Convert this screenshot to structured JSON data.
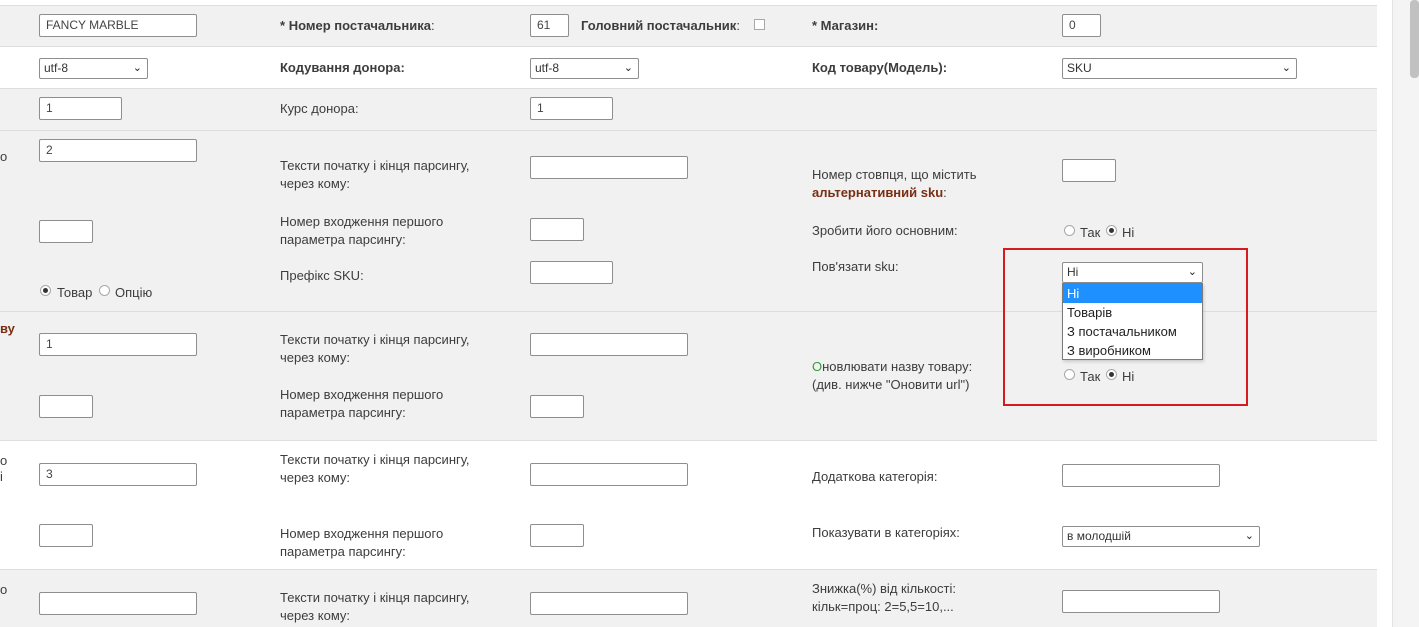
{
  "row1": {
    "name_value": "FANCY MARBLE",
    "supplier_number_label_star": "*",
    "supplier_number_label": "Номер постачальника",
    "supplier_number_colon": ":",
    "supplier_number_value": "61",
    "main_supplier_label": "Головний постачальник",
    "main_supplier_colon": ":",
    "store_label": "* Магазин:",
    "store_value": "0"
  },
  "row2": {
    "encoding_value": "utf-8",
    "donor_encoding_label": "Кодування донора:",
    "donor_encoding_value": "utf-8",
    "product_code_label": "Код товару(Модель):",
    "product_code_value": "SKU"
  },
  "row3": {
    "value1": "1",
    "donor_rate_label": "Курс донора:",
    "donor_rate_value": "1"
  },
  "section_sku": {
    "left_edge_char": "о",
    "column_value": "2",
    "texts_label_1": "Тексти початку і кінця парсингу,",
    "texts_label_2": "через кому:",
    "alt_col_label_1": "Номер стовпця, що містить",
    "alt_col_label_2": "альтернативний sku",
    "alt_col_label_3": ":",
    "first_occurrence_label_1": "Номер входження першого",
    "first_occurrence_label_2": "параметра парсингу:",
    "make_main_label": "Зробити його основним:",
    "yes": "Так",
    "no": "Ні",
    "sku_prefix_label": "Префікс SKU:",
    "link_sku_label": "Пов'язати sku:",
    "link_sku_value": "Ні",
    "type_product": "Товар",
    "type_option": "Опцію",
    "dropdown_options": [
      "Ні",
      "Товарів",
      "З постачальником",
      "З виробником"
    ]
  },
  "section_name": {
    "left_edge_text": "ву",
    "column_value": "1",
    "texts_label_1": "Тексти початку і кінця парсингу,",
    "texts_label_2": "через кому:",
    "update_name_first": "О",
    "update_name_rest": "новлювати назву товару:",
    "update_name_hint": "(див. нижче \"Оновити url\")",
    "first_occurrence_label_1": "Номер входження першого",
    "first_occurrence_label_2": "параметра парсингу:",
    "yes": "Так",
    "no": "Ні"
  },
  "section_category": {
    "left_edge_char_1": "о",
    "left_edge_char_2": "і",
    "column_value": "3",
    "texts_label_1": "Тексти початку і кінця парсингу,",
    "texts_label_2": "через кому:",
    "extra_category_label": "Додаткова категорія:",
    "first_occurrence_label_1": "Номер входження першого",
    "first_occurrence_label_2": "параметра парсингу:",
    "show_in_categories_label": "Показувати в категоріях:",
    "show_in_categories_value": "в молодшій"
  },
  "section_discount": {
    "left_edge_char": "о",
    "texts_label_1": "Тексти початку і кінця парсингу,",
    "texts_label_2": "через кому:",
    "discount_label_1": "Знижка(%) від кількості:",
    "discount_label_2": "кільк=проц: 2=5,5=10,..."
  },
  "colors": {
    "accent_brown": "#7a2e12",
    "highlight_blue": "#1e90ff",
    "annotation_red": "#d71920",
    "band_gray": "#f1f1f1"
  }
}
